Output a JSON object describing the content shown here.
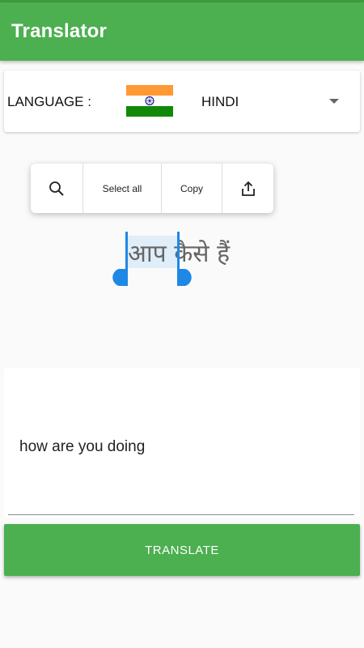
{
  "app": {
    "title": "Translator"
  },
  "language": {
    "label": "LANGUAGE :",
    "selected": "HINDI",
    "flag_icon": "india-flag-icon"
  },
  "selection_toolbar": {
    "search_icon": "search-icon",
    "select_all": "Select all",
    "copy": "Copy",
    "share_icon": "share-icon"
  },
  "output": {
    "translated_text": "आप कैसे हैं"
  },
  "input": {
    "text": "how are you doing"
  },
  "actions": {
    "translate_label": "TRANSLATE"
  },
  "colors": {
    "primary": "#4caf50",
    "selection_handle": "#1e88e5",
    "flag_saffron": "#ff9933",
    "flag_green": "#138808",
    "flag_chakra": "#000080"
  }
}
